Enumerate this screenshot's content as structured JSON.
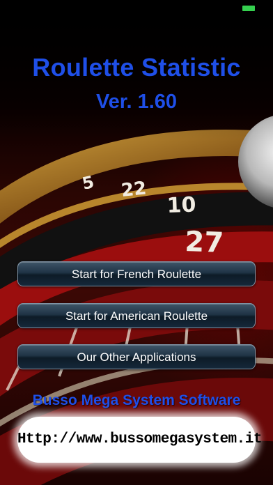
{
  "status_bar": {
    "battery_color": "#35d04f",
    "battery_icon": "battery-icon"
  },
  "header": {
    "title": "Roulette Statistic",
    "version": "Ver. 1.60",
    "title_color": "#1f4fe8"
  },
  "menu": {
    "french_label": "Start for French Roulette",
    "american_label": "Start for American Roulette",
    "other_label": "Our Other Applications"
  },
  "footer": {
    "company": "Busso Mega System Software",
    "website": "Http://www.bussomegasystem.it"
  },
  "background": {
    "image": "roulette-wheel",
    "wheel_numbers": [
      "5",
      "22",
      "10",
      "27"
    ]
  }
}
